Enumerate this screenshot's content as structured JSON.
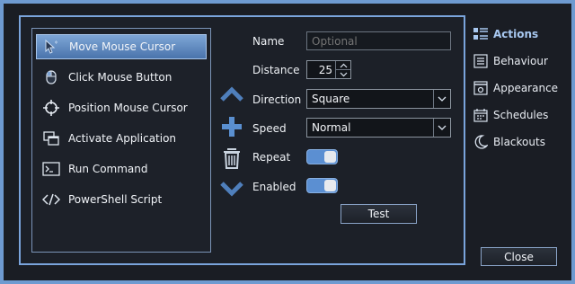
{
  "actions": {
    "items": [
      {
        "label": "Move Mouse Cursor",
        "icon": "mouse-cursor-icon",
        "selected": true
      },
      {
        "label": "Click Mouse Button",
        "icon": "mouse-icon",
        "selected": false
      },
      {
        "label": "Position Mouse Cursor",
        "icon": "crosshair-icon",
        "selected": false
      },
      {
        "label": "Activate Application",
        "icon": "windows-icon",
        "selected": false
      },
      {
        "label": "Run Command",
        "icon": "terminal-icon",
        "selected": false
      },
      {
        "label": "PowerShell Script",
        "icon": "code-icon",
        "selected": false
      }
    ]
  },
  "form": {
    "name_label": "Name",
    "name_placeholder": "Optional",
    "name_value": "",
    "distance_label": "Distance",
    "distance_value": "25",
    "direction_label": "Direction",
    "direction_value": "Square",
    "speed_label": "Speed",
    "speed_value": "Normal",
    "repeat_label": "Repeat",
    "repeat_on": true,
    "enabled_label": "Enabled",
    "enabled_on": true,
    "test_label": "Test"
  },
  "nav": {
    "items": [
      {
        "label": "Actions",
        "icon": "list-icon",
        "active": true
      },
      {
        "label": "Behaviour",
        "icon": "settings-list-icon",
        "active": false
      },
      {
        "label": "Appearance",
        "icon": "appearance-icon",
        "active": false
      },
      {
        "label": "Schedules",
        "icon": "calendar-icon",
        "active": false
      },
      {
        "label": "Blackouts",
        "icon": "moon-icon",
        "active": false
      }
    ]
  },
  "close_label": "Close",
  "colors": {
    "accent": "#6e9ad0",
    "selected": "#5b86bf",
    "toggle": "#5b8fd2"
  }
}
